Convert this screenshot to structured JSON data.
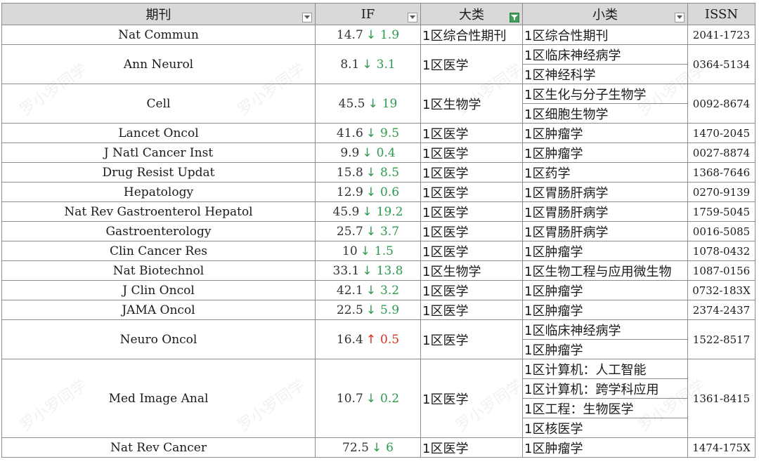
{
  "headers": {
    "journal": "期刊",
    "if": "IF",
    "category": "大类",
    "subcategory": "小类",
    "issn": "ISSN"
  },
  "colors": {
    "header_bg": "#d9d9d9",
    "down": "#2e9a4f",
    "up": "#d93025",
    "filter_active": "#3f9f5a"
  },
  "watermark": "罗小罗同学",
  "rows": [
    {
      "journal": "Nat Commun",
      "if": "14.7",
      "dir": "down",
      "delta": "1.9",
      "category": "1区综合性期刊",
      "subs": [
        "1区综合性期刊"
      ],
      "issn": "2041-1723"
    },
    {
      "journal": "Ann Neurol",
      "if": "8.1",
      "dir": "down",
      "delta": "3.1",
      "category": "1区医学",
      "subs": [
        "1区临床神经病学",
        "1区神经科学"
      ],
      "issn": "0364-5134"
    },
    {
      "journal": "Cell",
      "if": "45.5",
      "dir": "down",
      "delta": "19",
      "category": "1区生物学",
      "subs": [
        "1区生化与分子生物学",
        "1区细胞生物学"
      ],
      "issn": "0092-8674"
    },
    {
      "journal": "Lancet Oncol",
      "if": "41.6",
      "dir": "down",
      "delta": "9.5",
      "category": "1区医学",
      "subs": [
        "1区肿瘤学"
      ],
      "issn": "1470-2045"
    },
    {
      "journal": "J Natl Cancer Inst",
      "if": "9.9",
      "dir": "down",
      "delta": "0.4",
      "category": "1区医学",
      "subs": [
        "1区肿瘤学"
      ],
      "issn": "0027-8874"
    },
    {
      "journal": "Drug Resist Updat",
      "if": "15.8",
      "dir": "down",
      "delta": "8.5",
      "category": "1区医学",
      "subs": [
        "1区药学"
      ],
      "issn": "1368-7646"
    },
    {
      "journal": "Hepatology",
      "if": "12.9",
      "dir": "down",
      "delta": "0.6",
      "category": "1区医学",
      "subs": [
        "1区胃肠肝病学"
      ],
      "issn": "0270-9139"
    },
    {
      "journal": "Nat Rev Gastroenterol Hepatol",
      "if": "45.9",
      "dir": "down",
      "delta": "19.2",
      "category": "1区医学",
      "subs": [
        "1区胃肠肝病学"
      ],
      "issn": "1759-5045"
    },
    {
      "journal": "Gastroenterology",
      "if": "25.7",
      "dir": "down",
      "delta": "3.7",
      "category": "1区医学",
      "subs": [
        "1区胃肠肝病学"
      ],
      "issn": "0016-5085"
    },
    {
      "journal": "Clin Cancer Res",
      "if": "10",
      "dir": "down",
      "delta": "1.5",
      "category": "1区医学",
      "subs": [
        "1区肿瘤学"
      ],
      "issn": "1078-0432"
    },
    {
      "journal": "Nat Biotechnol",
      "if": "33.1",
      "dir": "down",
      "delta": "13.8",
      "category": "1区生物学",
      "subs": [
        "1区生物工程与应用微生物"
      ],
      "issn": "1087-0156"
    },
    {
      "journal": "J Clin Oncol",
      "if": "42.1",
      "dir": "down",
      "delta": "3.2",
      "category": "1区医学",
      "subs": [
        "1区肿瘤学"
      ],
      "issn": "0732-183X"
    },
    {
      "journal": "JAMA Oncol",
      "if": "22.5",
      "dir": "down",
      "delta": "5.9",
      "category": "1区医学",
      "subs": [
        "1区肿瘤学"
      ],
      "issn": "2374-2437"
    },
    {
      "journal": "Neuro Oncol",
      "if": "16.4",
      "dir": "up",
      "delta": "0.5",
      "category": "1区医学",
      "subs": [
        "1区临床神经病学",
        "1区肿瘤学"
      ],
      "issn": "1522-8517"
    },
    {
      "journal": "Med Image Anal",
      "if": "10.7",
      "dir": "down",
      "delta": "0.2",
      "category": "1区医学",
      "subs": [
        "1区计算机：人工智能",
        "1区计算机：跨学科应用",
        "1区工程：生物医学",
        "1区核医学"
      ],
      "issn": "1361-8415"
    },
    {
      "journal": "Nat Rev Cancer",
      "if": "72.5",
      "dir": "down",
      "delta": "6",
      "category": "1区医学",
      "subs": [
        "1区肿瘤学"
      ],
      "issn": "1474-175X"
    }
  ]
}
